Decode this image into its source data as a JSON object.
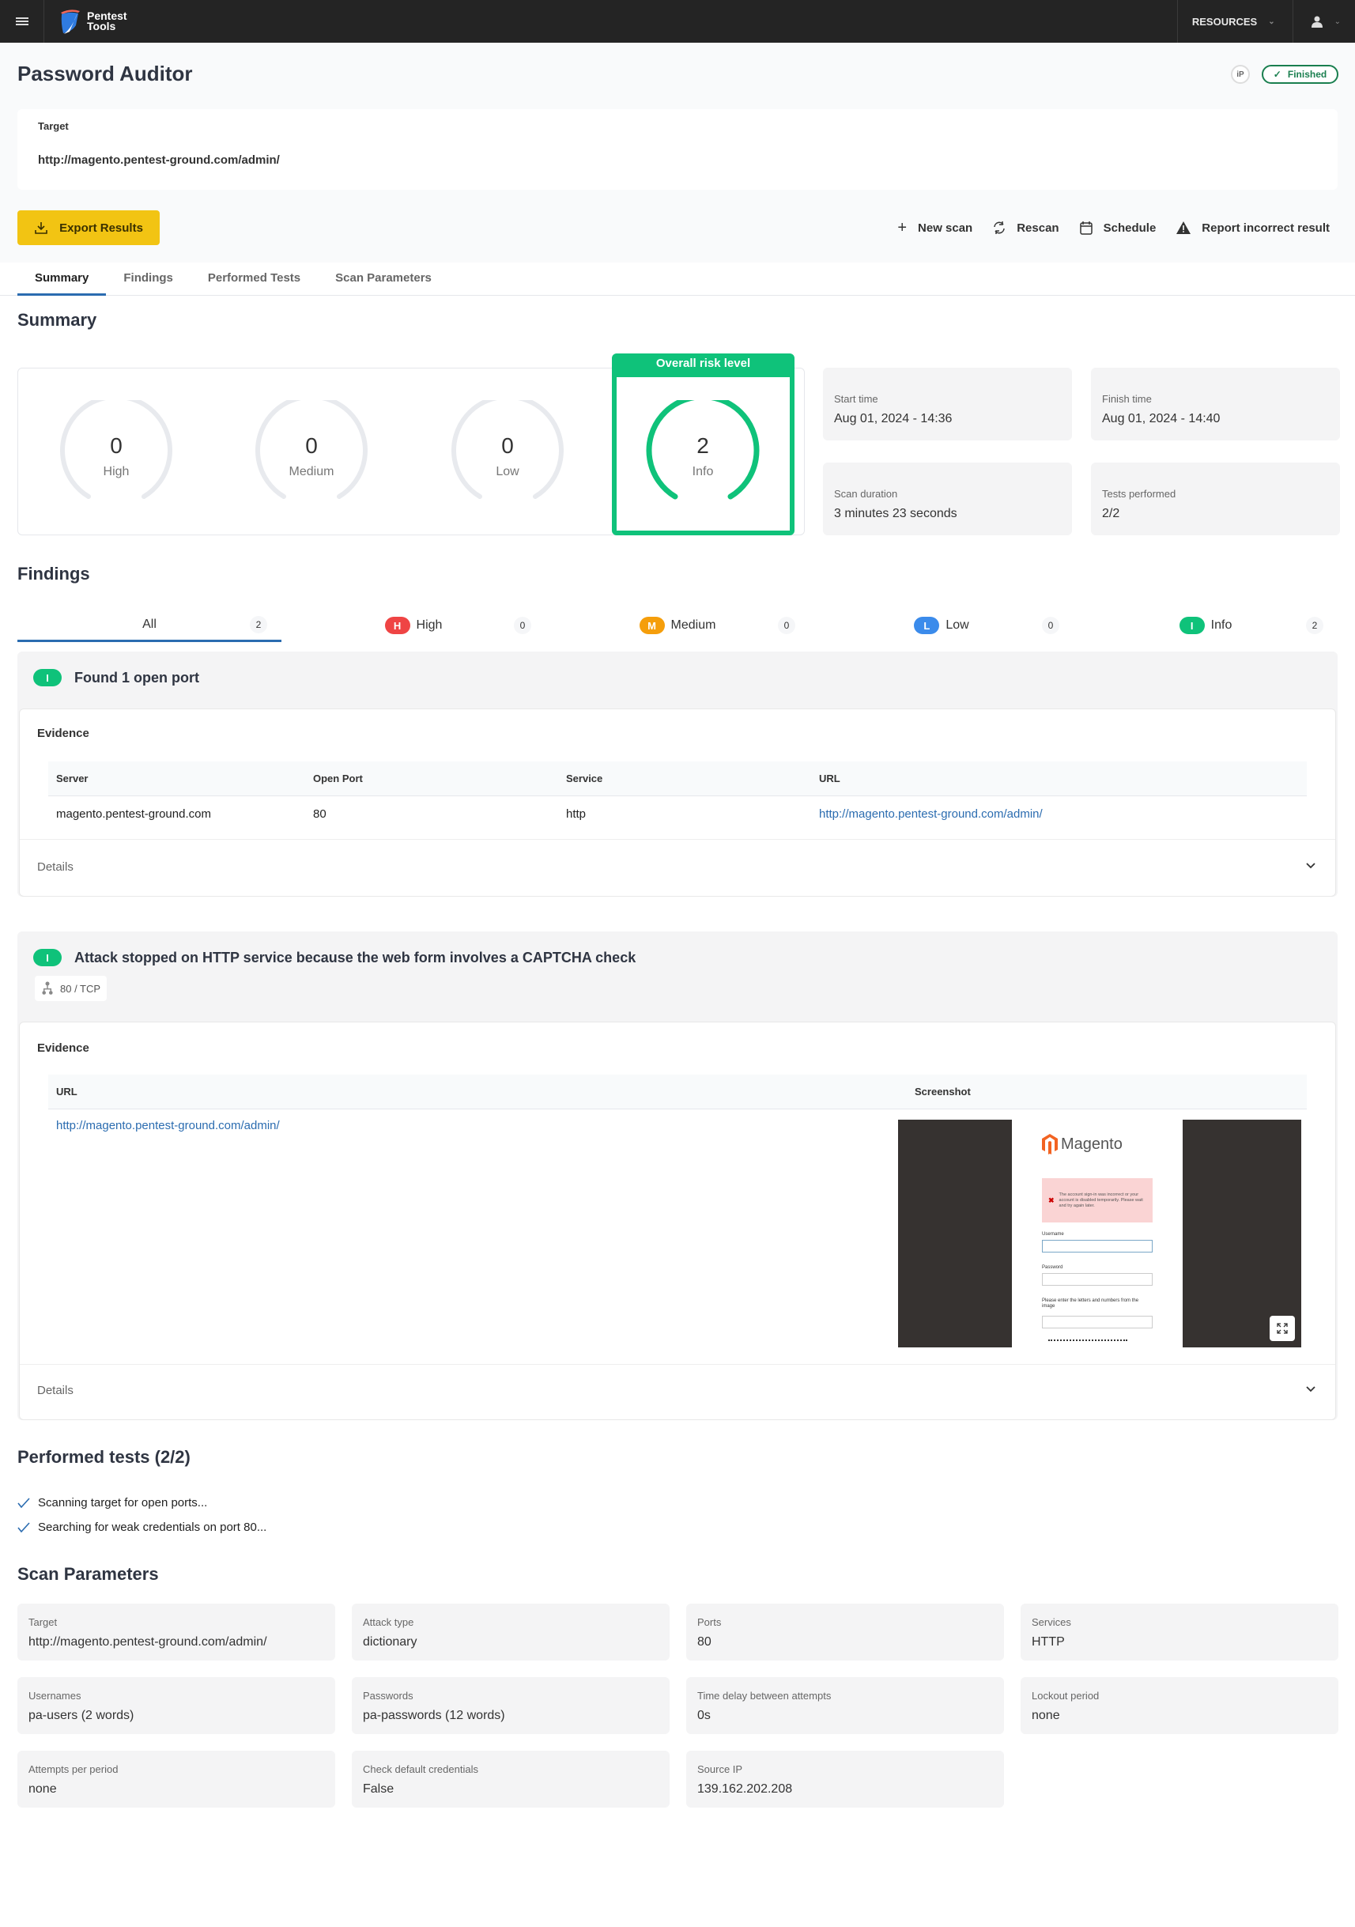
{
  "nav": {
    "logo_line1": "Pentest",
    "logo_line2": "Tools",
    "resources_label": "RESOURCES"
  },
  "page": {
    "title": "Password Auditor",
    "ip_badge": "iP",
    "status": "Finished"
  },
  "target": {
    "label": "Target",
    "value": "http://magento.pentest-ground.com/admin/"
  },
  "toolbar": {
    "export_label": "Export Results",
    "new_scan_label": "New scan",
    "rescan_label": "Rescan",
    "schedule_label": "Schedule",
    "report_label": "Report incorrect result"
  },
  "tabs": [
    {
      "label": "Summary",
      "active": true
    },
    {
      "label": "Findings",
      "active": false
    },
    {
      "label": "Performed Tests",
      "active": false
    },
    {
      "label": "Scan Parameters",
      "active": false
    }
  ],
  "summary": {
    "title": "Summary",
    "gauges": [
      {
        "label": "High",
        "count": 0
      },
      {
        "label": "Medium",
        "count": 0
      },
      {
        "label": "Low",
        "count": 0
      }
    ],
    "overall": {
      "title": "Overall risk level",
      "label": "Info",
      "count": 2
    },
    "stats": [
      {
        "label": "Start time",
        "value": "Aug 01, 2024 - 14:36"
      },
      {
        "label": "Finish time",
        "value": "Aug 01, 2024 - 14:40"
      },
      {
        "label": "Scan duration",
        "value": "3 minutes 23 seconds"
      },
      {
        "label": "Tests performed",
        "value": "2/2"
      }
    ]
  },
  "findings": {
    "title": "Findings",
    "filters": [
      {
        "label": "All",
        "count": "2"
      },
      {
        "label": "High",
        "badge": "H",
        "count": "0",
        "color": "#ef4444"
      },
      {
        "label": "Medium",
        "badge": "M",
        "count": "0",
        "color": "#f59e0b"
      },
      {
        "label": "Low",
        "badge": "L",
        "count": "0",
        "color": "#3b8beb"
      },
      {
        "label": "Info",
        "badge": "I",
        "count": "2",
        "color": "#0fc27a"
      }
    ],
    "items": [
      {
        "badge": "I",
        "title": "Found 1 open port",
        "evidence_label": "Evidence",
        "columns": [
          "Server",
          "Open Port",
          "Service",
          "URL"
        ],
        "rows": [
          [
            "magento.pentest-ground.com",
            "80",
            "http",
            "http://magento.pentest-ground.com/admin/"
          ]
        ],
        "details_label": "Details"
      },
      {
        "badge": "I",
        "title": "Attack stopped on HTTP service because the web form involves a CAPTCHA check",
        "port_chip": "80 / TCP",
        "evidence_label": "Evidence",
        "columns": [
          "URL",
          "Screenshot"
        ],
        "rows": [
          [
            "http://magento.pentest-ground.com/admin/"
          ]
        ],
        "screenshot": {
          "brand": "Magento",
          "error": "The account sign-in was incorrect or your account is disabled temporarily. Please wait and try again later.",
          "username_label": "Username",
          "password_label": "Password",
          "captcha_label": "Please enter the letters and numbers from the image"
        },
        "details_label": "Details"
      }
    ]
  },
  "performed_tests": {
    "title": "Performed tests (2/2)",
    "items": [
      "Scanning target for open ports...",
      "Searching for weak credentials on port 80..."
    ]
  },
  "scan_parameters": {
    "title": "Scan Parameters",
    "items": [
      {
        "label": "Target",
        "value": "http://magento.pentest-ground.com/admin/"
      },
      {
        "label": "Attack type",
        "value": "dictionary"
      },
      {
        "label": "Ports",
        "value": "80"
      },
      {
        "label": "Services",
        "value": "HTTP"
      },
      {
        "label": "Usernames",
        "value": "pa-users (2 words)"
      },
      {
        "label": "Passwords",
        "value": "pa-passwords (12 words)"
      },
      {
        "label": "Time delay between attempts",
        "value": "0s"
      },
      {
        "label": "Lockout period",
        "value": "none"
      },
      {
        "label": "Attempts per period",
        "value": "none"
      },
      {
        "label": "Check default credentials",
        "value": "False"
      },
      {
        "label": "Source IP",
        "value": "139.162.202.208"
      }
    ]
  }
}
